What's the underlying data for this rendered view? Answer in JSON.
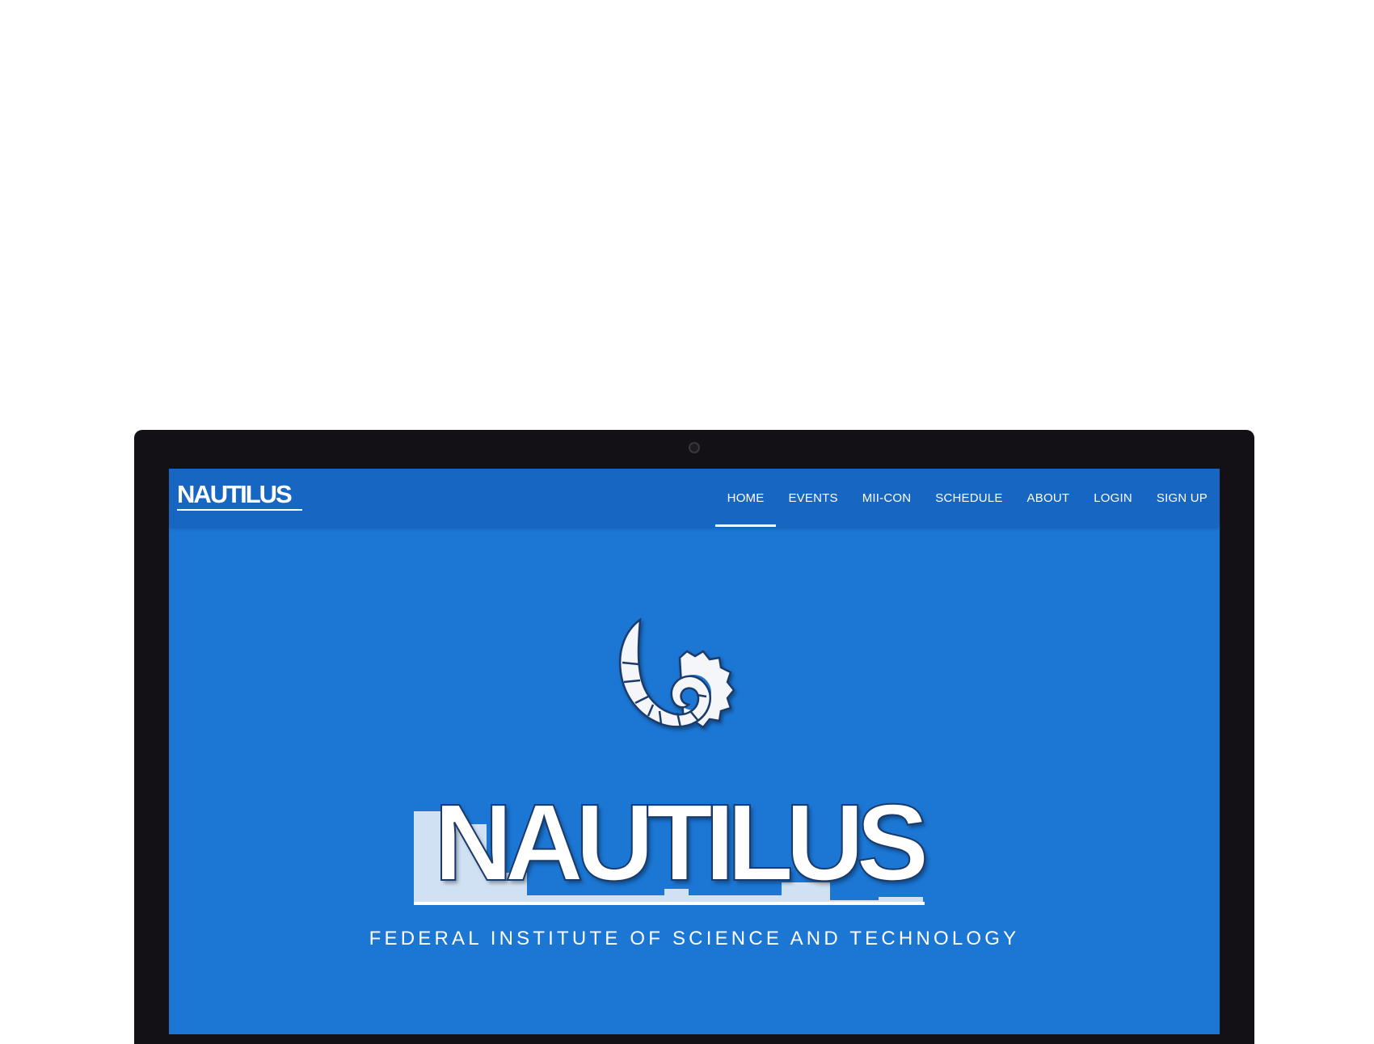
{
  "navbar": {
    "brand": "NAUTILUS",
    "links": [
      "HOME",
      "EVENTS",
      "MII-CON",
      "SCHEDULE",
      "ABOUT",
      "LOGIN",
      "SIGN UP"
    ],
    "active": "HOME"
  },
  "hero": {
    "wordmark": "NAUTILUS",
    "tagline": "FEDERAL INSTITUTE OF SCIENCE AND TECHNOLOGY"
  },
  "colors": {
    "screen_bg": "#1b76d4",
    "navbar_bg": "#1766c2",
    "bezel": "#131016"
  },
  "icons": [
    "camera-icon",
    "nautilus-shell-gear-logo"
  ]
}
